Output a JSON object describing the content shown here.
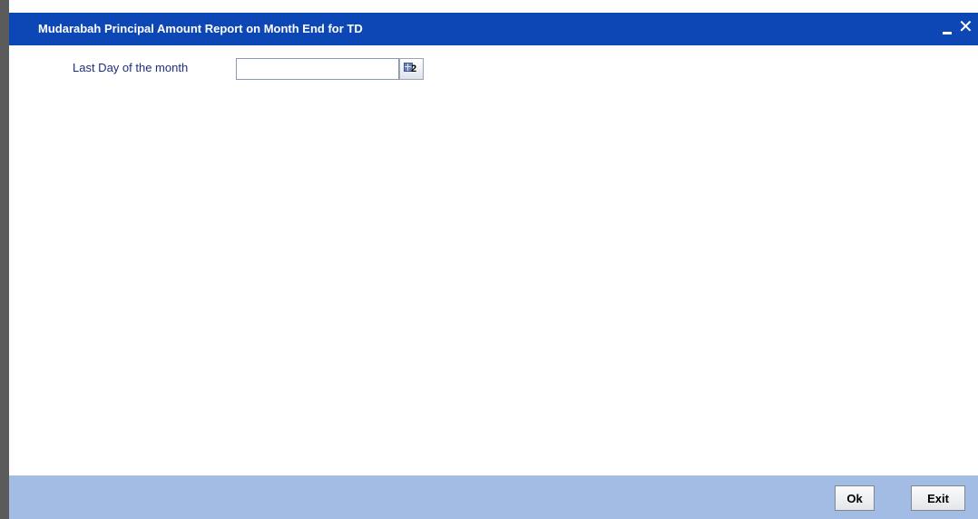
{
  "window": {
    "title": "Mudarabah Principal Amount Report on Month End for TD",
    "minimize_icon": "minimize-icon",
    "close_glyph": "✕",
    "close_icon": "close-icon"
  },
  "form": {
    "last_day_label": "Last Day of the month",
    "last_day_value": "",
    "calendar_icon": "calendar-icon",
    "calendar_icon_number": "2"
  },
  "footer": {
    "ok_label": "Ok",
    "exit_label": "Exit"
  },
  "colors": {
    "titlebar": "#0d47b5",
    "footer": "#a3bce3",
    "label_text": "#1c2e82"
  }
}
